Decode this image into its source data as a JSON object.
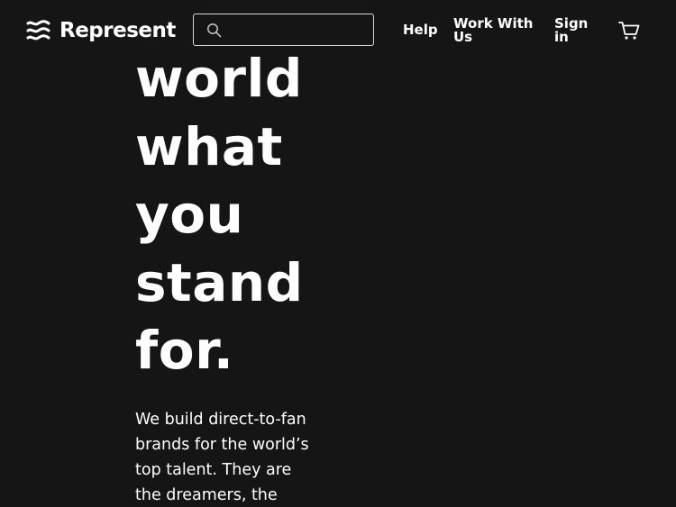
{
  "header": {
    "brand": "Represent",
    "search": {
      "placeholder": "",
      "value": ""
    },
    "nav": {
      "help": "Help",
      "work_with_us": "Work With Us",
      "sign_in": "Sign in"
    },
    "icons": {
      "logo": "waves-logo-icon",
      "search": "search-icon",
      "cart": "cart-icon"
    }
  },
  "hero": {
    "lines": [
      "world",
      "what",
      "you",
      "stand",
      "for."
    ]
  },
  "intro": {
    "lines": [
      "We build direct-to-fan",
      "brands for the world’s",
      "top talent. They are",
      "the dreamers, the"
    ]
  },
  "colors": {
    "background": "#161515",
    "text": "#ffffff",
    "search_border": "#d9d9d9"
  }
}
